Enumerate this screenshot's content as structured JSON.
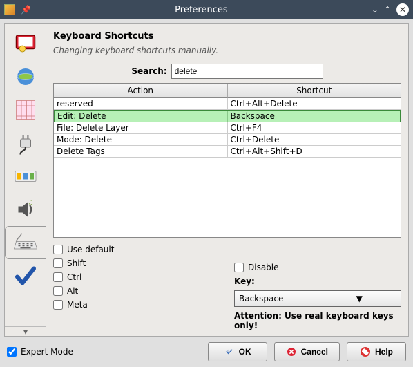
{
  "window": {
    "title": "Preferences"
  },
  "panel": {
    "title": "Keyboard Shortcuts",
    "subtitle": "Changing keyboard shortcuts manually.",
    "search_label": "Search:",
    "search_value": "delete"
  },
  "table": {
    "headers": {
      "action": "Action",
      "shortcut": "Shortcut"
    },
    "rows": [
      {
        "action": "reserved",
        "shortcut": "Ctrl+Alt+Delete",
        "selected": false
      },
      {
        "action": "Edit: Delete",
        "shortcut": "Backspace",
        "selected": true
      },
      {
        "action": "File: Delete Layer",
        "shortcut": "Ctrl+F4",
        "selected": false
      },
      {
        "action": "Mode: Delete",
        "shortcut": "Ctrl+Delete",
        "selected": false
      },
      {
        "action": "Delete Tags",
        "shortcut": "Ctrl+Alt+Shift+D",
        "selected": false
      }
    ]
  },
  "options": {
    "use_default": "Use default",
    "shift": "Shift",
    "ctrl": "Ctrl",
    "alt": "Alt",
    "meta": "Meta",
    "disable": "Disable",
    "key_label": "Key:",
    "key_value": "Backspace",
    "attention": "Attention: Use real keyboard keys only!"
  },
  "footer": {
    "expert": "Expert Mode",
    "ok": "OK",
    "cancel": "Cancel",
    "help": "Help"
  },
  "tabs": [
    {
      "name": "display-settings",
      "icon": "display"
    },
    {
      "name": "globe",
      "icon": "globe"
    },
    {
      "name": "grid",
      "icon": "grid"
    },
    {
      "name": "plugins",
      "icon": "plug"
    },
    {
      "name": "toolbars",
      "icon": "toolbar"
    },
    {
      "name": "audio",
      "icon": "audio"
    },
    {
      "name": "keyboard",
      "icon": "keyboard",
      "active": true
    },
    {
      "name": "validator",
      "icon": "check"
    }
  ]
}
